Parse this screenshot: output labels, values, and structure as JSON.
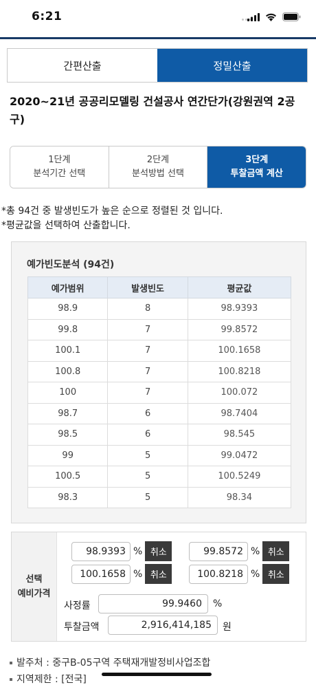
{
  "status": {
    "time": "6:21"
  },
  "main_tabs": [
    {
      "label": "간편산출",
      "active": false
    },
    {
      "label": "정밀산출",
      "active": true
    }
  ],
  "page_title": "2020~21년 공공리모델링 건설공사 연간단가(강원권역 2공구)",
  "steps": [
    {
      "line1": "1단계",
      "line2": "분석기간 선택",
      "active": false
    },
    {
      "line1": "2단계",
      "line2": "분석방법 선택",
      "active": false
    },
    {
      "line1": "3단계",
      "line2": "투찰금액 계산",
      "active": true
    }
  ],
  "notes": [
    "*총 94건 중 발생빈도가 높은 순으로 정렬된 것 입니다.",
    "*평균값을 선택하여 산출합니다."
  ],
  "freq": {
    "title": "예가빈도분석 (94건)",
    "headers": [
      "예가범위",
      "발생빈도",
      "평균값"
    ],
    "rows": [
      [
        "98.9",
        "8",
        "98.9393"
      ],
      [
        "99.8",
        "7",
        "99.8572"
      ],
      [
        "100.1",
        "7",
        "100.1658"
      ],
      [
        "100.8",
        "7",
        "100.8218"
      ],
      [
        "100",
        "7",
        "100.072"
      ],
      [
        "98.7",
        "6",
        "98.7404"
      ],
      [
        "98.5",
        "6",
        "98.545"
      ],
      [
        "99",
        "5",
        "99.0472"
      ],
      [
        "100.5",
        "5",
        "100.5249"
      ],
      [
        "98.3",
        "5",
        "98.34"
      ]
    ]
  },
  "selection": {
    "label_line1": "선택",
    "label_line2": "예비가격",
    "percent": "%",
    "cancel_label": "취소",
    "picks": [
      "98.9393",
      "99.8572",
      "100.1658",
      "100.8218"
    ],
    "rate_label": "사정률",
    "rate_value": "99.9460",
    "rate_unit": "%",
    "amount_label": "투찰금액",
    "amount_value": "2,916,414,185",
    "amount_unit": "원"
  },
  "info": {
    "orderer": "발주처 : 중구B-05구역 주택재개발정비사업조합",
    "region": "지역제한 : [전국]"
  }
}
